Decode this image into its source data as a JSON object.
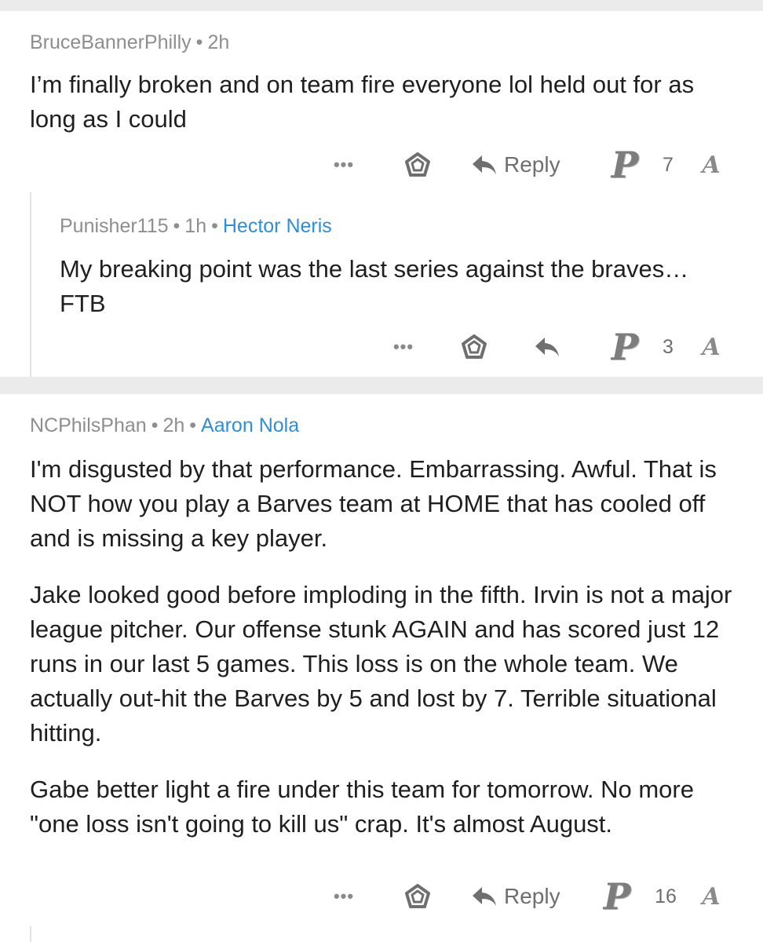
{
  "comments": [
    {
      "author": "BruceBannerPhilly",
      "time": "2h",
      "flair": "",
      "paragraphs": [
        "I’m finally broken and on team fire everyone lol held out for as long as I could"
      ],
      "more": "•••",
      "reply_label": "Reply",
      "score": "7"
    },
    {
      "author": "Punisher115",
      "time": "1h",
      "flair": "Hector Neris",
      "paragraphs": [
        "My breaking point was the last series against the braves…  FTB"
      ],
      "more": "•••",
      "reply_label": "",
      "score": "3"
    },
    {
      "author": "NCPhilsPhan",
      "time": "2h",
      "flair": "Aaron Nola",
      "paragraphs": [
        "I'm disgusted by that performance. Embarrassing. Awful. That is NOT how you play a Barves team at HOME that has cooled off and is missing a key player.",
        "Jake looked good before imploding in the fifth. Irvin is not a major league pitcher. Our offense stunk AGAIN and has scored just 12 runs in our last 5 games. This loss is on the whole team. We actually out-hit the Barves by 5 and lost by 7. Terrible situational hitting.",
        "Gabe better light a fire under this team for tomorrow. No more \"one loss isn't going to kill us\" crap. It's almost August."
      ],
      "more": "•••",
      "reply_label": "Reply",
      "score": "16"
    }
  ],
  "separator": "•",
  "team_logo_text": "P",
  "opponent_logo_text": "A",
  "colors": {
    "meta": "#8e8e8e",
    "flair": "#2e8ed8",
    "separator_bg": "#ebebeb"
  }
}
